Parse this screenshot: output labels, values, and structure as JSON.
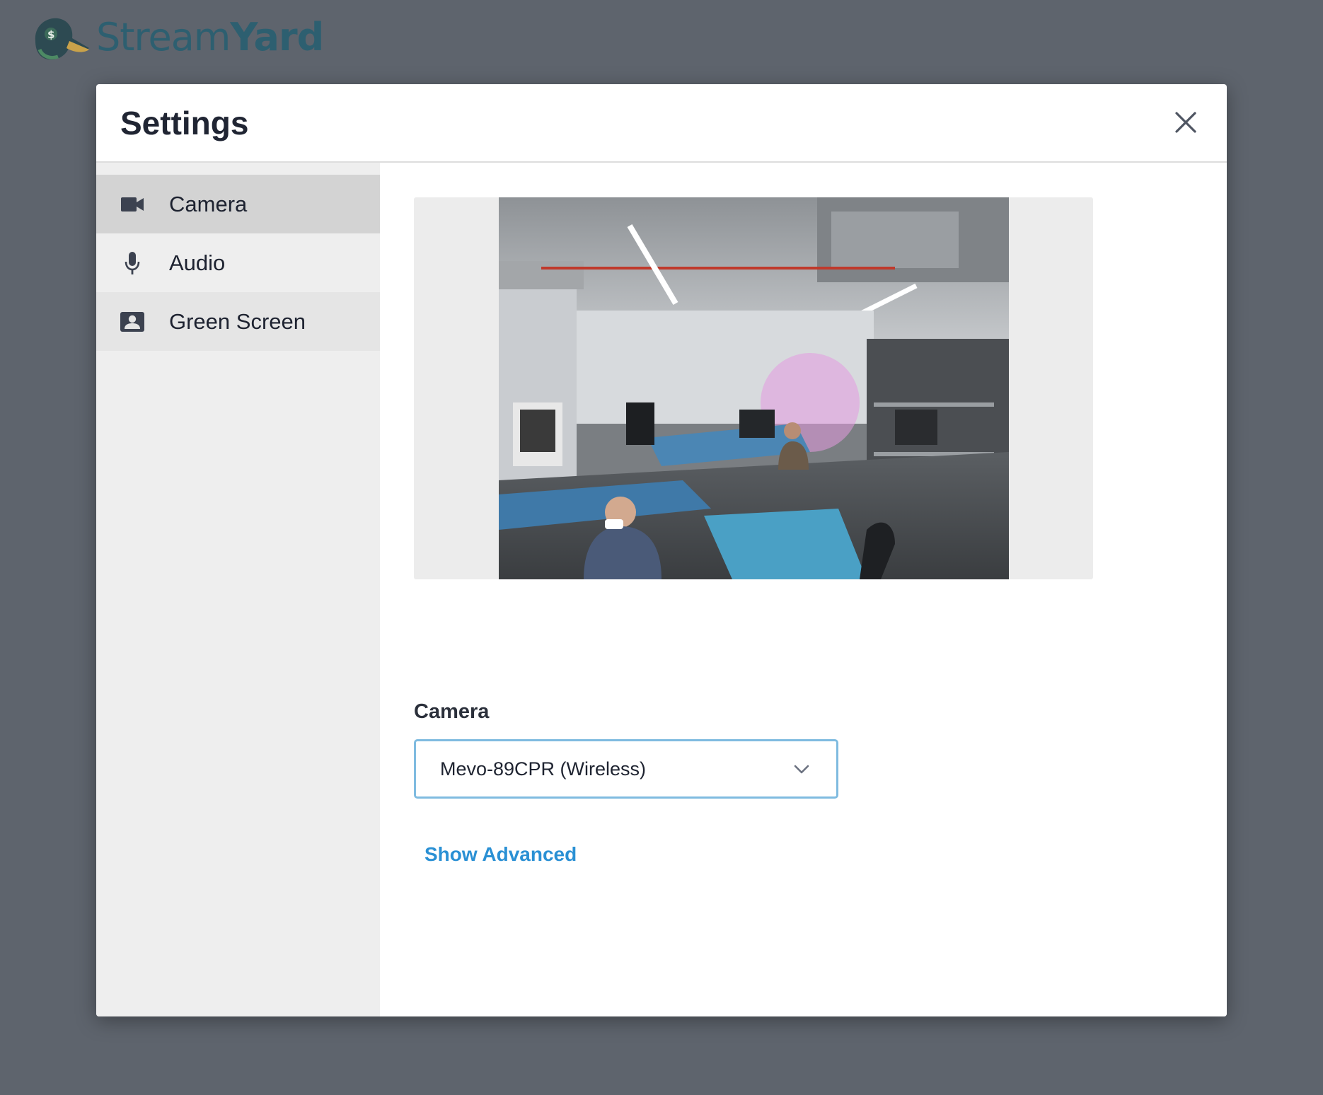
{
  "brand": {
    "name_light": "Stream",
    "name_bold": "Yard",
    "logo_icon": "duck-logo-icon"
  },
  "modal": {
    "title": "Settings",
    "close_icon": "close-icon"
  },
  "sidebar": {
    "items": [
      {
        "label": "Camera",
        "icon": "video-camera-icon",
        "active": true
      },
      {
        "label": "Audio",
        "icon": "microphone-icon",
        "active": false
      },
      {
        "label": "Green Screen",
        "icon": "portrait-card-icon",
        "active": false
      }
    ]
  },
  "camera": {
    "field_label": "Camera",
    "selected_device": "Mevo-89CPR (Wireless)",
    "show_advanced_label": "Show Advanced"
  },
  "colors": {
    "accent": "#2a90d4",
    "select_border": "#7fbbe0",
    "backdrop": "#5e646d",
    "brand": "#2d5f70"
  }
}
